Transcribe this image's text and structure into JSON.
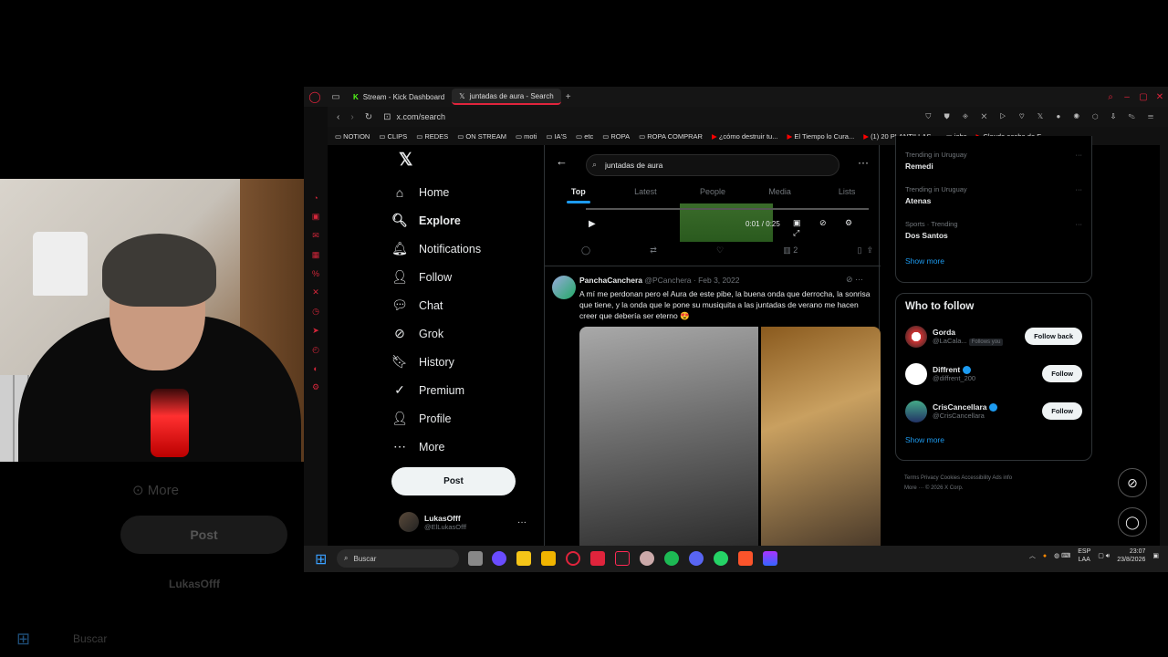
{
  "ghost": {
    "more": "More",
    "post": "Post",
    "account": "LukasOfff",
    "search": "Buscar"
  },
  "browser": {
    "tabs": [
      {
        "label": "Stream - Kick Dashboard",
        "icon": "kick-icon"
      },
      {
        "label": "juntadas de aura - Search",
        "icon": "x-logo-icon"
      }
    ],
    "url": "x.com/search",
    "bookmarks": [
      "NOTION",
      "CLIPS",
      "REDES",
      "ON STREAM",
      "moti",
      "IA'S",
      "etc",
      "ROPA",
      "ROPA COMPRAR",
      "¿cómo destruir tu...",
      "El Tiempo lo Cura...",
      "(1) 20 PLANTILLAS...",
      "jobs",
      "Claude acaba de E..."
    ]
  },
  "nav": {
    "items": [
      {
        "label": "Home",
        "icon": "⌂"
      },
      {
        "label": "Explore",
        "icon": "🔍︎"
      },
      {
        "label": "Notifications",
        "icon": "🔔︎"
      },
      {
        "label": "Follow",
        "icon": "👤︎"
      },
      {
        "label": "Chat",
        "icon": "💬︎"
      },
      {
        "label": "Grok",
        "icon": "⊘"
      },
      {
        "label": "History",
        "icon": "🔖︎"
      },
      {
        "label": "Premium",
        "icon": "✓"
      },
      {
        "label": "Profile",
        "icon": "👤︎"
      },
      {
        "label": "More",
        "icon": "⋯"
      }
    ],
    "post": "Post",
    "account": {
      "name": "LukasOfff",
      "handle": "@ElLukasOfff"
    }
  },
  "search": {
    "query": "juntadas de aura",
    "tabs": [
      "Top",
      "Latest",
      "People",
      "Media",
      "Lists"
    ]
  },
  "video": {
    "time": "0:01 / 0:25"
  },
  "actions": {
    "views": "2"
  },
  "tweet": {
    "name": "PanchaCanchera",
    "handle": "@PCanchera · Feb 3, 2022",
    "text": "A mí me perdonan pero el Aura de este pibe, la buena onda que derrocha, la sonrisa que tiene, y la onda que le pone su musiquita a las juntadas de verano me hacen creer que debería ser eterno 😍"
  },
  "trends": [
    {
      "cat": "Trending in Uruguay",
      "name": "Remedi"
    },
    {
      "cat": "Trending in Uruguay",
      "name": "Atenas"
    },
    {
      "cat": "Sports · Trending",
      "name": "Dos Santos"
    }
  ],
  "show_more": "Show more",
  "who": {
    "title": "Who to follow",
    "people": [
      {
        "name": "Gorda",
        "handle": "@LaCala...",
        "tag": "Follows you",
        "btn": "Follow back"
      },
      {
        "name": "Diffrent",
        "handle": "@diffrent_200",
        "tag": "",
        "btn": "Follow"
      },
      {
        "name": "CrisCancellara",
        "handle": "@CrisCancellara",
        "tag": "",
        "btn": "Follow"
      }
    ]
  },
  "footer": {
    "line1": "Terms   Privacy   Cookies   Accessibility   Ads info",
    "line2": "More ···   © 2026 X Corp."
  },
  "taskbar": {
    "search": "Buscar",
    "lang1": "ESP",
    "lang2": "LAA",
    "time": "23:07",
    "date": "23/8/2026"
  },
  "colors": {
    "accent": "#1d9bf0",
    "opera_red": "#e0243c"
  }
}
